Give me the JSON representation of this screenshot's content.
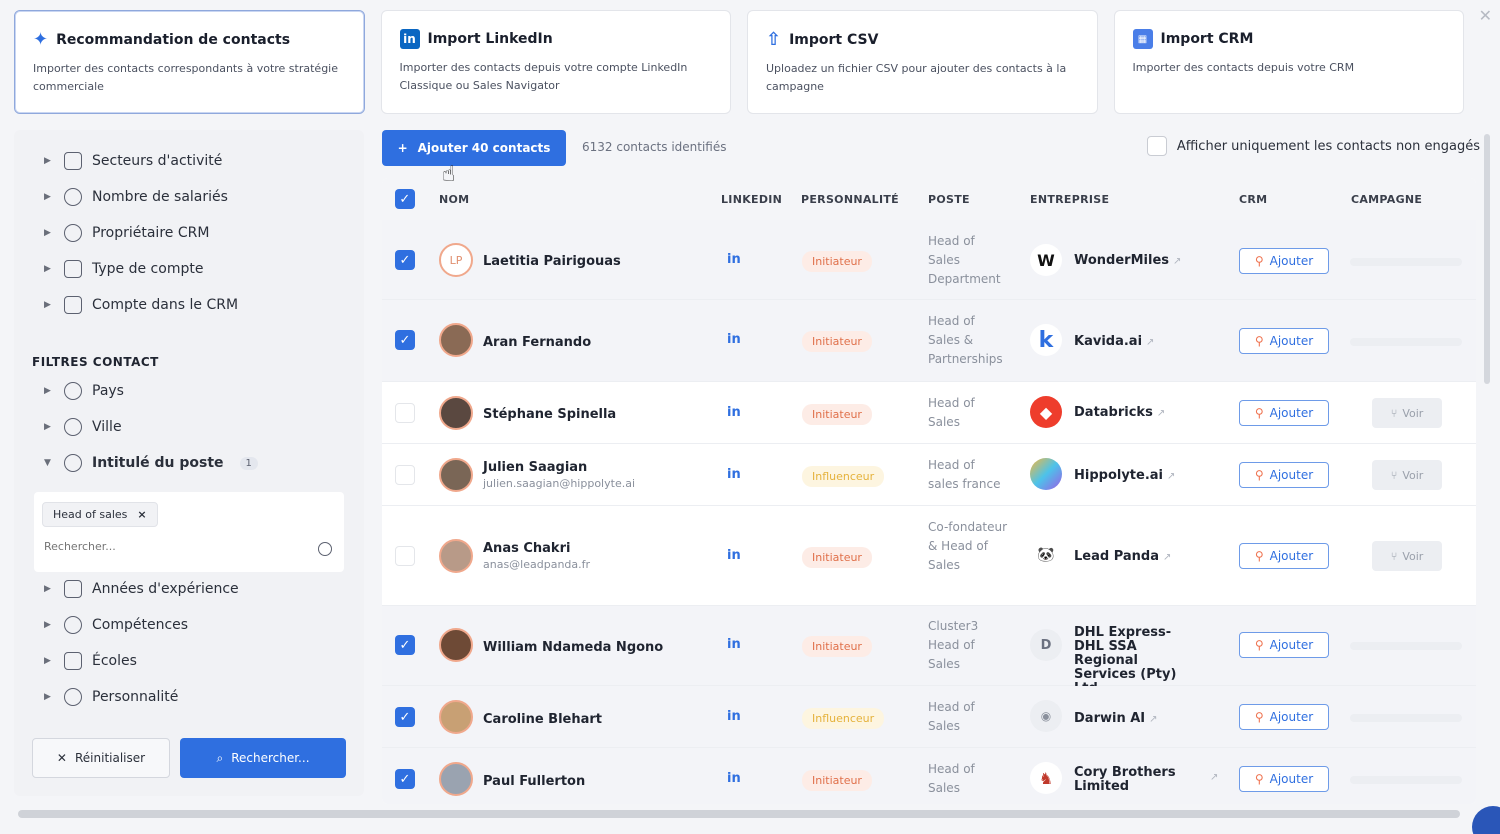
{
  "import_cards": [
    {
      "title": "Recommandation de contacts",
      "desc": "Importer des contacts correspondants à votre stratégie commerciale",
      "icon": "sparkles-icon"
    },
    {
      "title": "Import LinkedIn",
      "desc": "Importer des contacts depuis votre compte LinkedIn Classique ou Sales Navigator",
      "icon": "linkedin-icon"
    },
    {
      "title": "Import CSV",
      "desc": "Uploadez un fichier CSV pour ajouter des contacts à la campagne",
      "icon": "upload-icon"
    },
    {
      "title": "Import CRM",
      "desc": "Importer des contacts depuis votre CRM",
      "icon": "crm-icon"
    }
  ],
  "sidebar": {
    "company_filters": [
      {
        "label": "Secteurs d'activité",
        "icon": "truck-icon"
      },
      {
        "label": "Nombre de salariés",
        "icon": "users-icon"
      },
      {
        "label": "Propriétaire CRM",
        "icon": "user-icon"
      },
      {
        "label": "Type de compte",
        "icon": "handshake-icon"
      },
      {
        "label": "Compte dans le CRM",
        "icon": "building-icon"
      }
    ],
    "section_title": "FILTRES CONTACT",
    "contact_filters_top": [
      {
        "label": "Pays",
        "icon": "pin-icon"
      },
      {
        "label": "Ville",
        "icon": "pin-icon"
      }
    ],
    "job_filter": {
      "label": "Intitulé du poste",
      "count": "1",
      "chip": "Head of sales",
      "chip_remove": "×",
      "search_placeholder": "Rechercher..."
    },
    "contact_filters_bottom": [
      {
        "label": "Années d'expérience",
        "icon": "calendar-icon"
      },
      {
        "label": "Compétences",
        "icon": "bulb-icon"
      },
      {
        "label": "Écoles",
        "icon": "graduation-icon"
      },
      {
        "label": "Personnalité",
        "icon": "target-icon"
      }
    ],
    "reset_label": "Réinitialiser",
    "search_label": "Rechercher..."
  },
  "toolbar": {
    "add_label": "Ajouter 40 contacts",
    "count_text": "6132 contacts identifiés",
    "only_label": "Afficher uniquement les contacts non engagés"
  },
  "table": {
    "headers": {
      "nom": "NOM",
      "linkedin": "LINKEDIN",
      "perso": "PERSONNALITÉ",
      "poste": "POSTE",
      "entreprise": "ENTREPRISE",
      "crm": "CRM",
      "campagne": "CAMPAGNE"
    },
    "crm_label": "Ajouter",
    "voir_label": "Voir",
    "li_label": "in",
    "rows": [
      {
        "name": "Laetitia Pairigouas",
        "email": "",
        "initials": "LP",
        "perso": "Initiateur",
        "poste": "Head of Sales Department",
        "company": "WonderMiles",
        "logo": "W",
        "checked": true
      },
      {
        "name": "Aran Fernando",
        "email": "",
        "initials": "",
        "perso": "Initiateur",
        "poste": "Head of Sales & Partnerships",
        "company": "Kavida.ai",
        "logo": "k",
        "checked": true
      },
      {
        "name": "Stéphane Spinella",
        "email": "",
        "initials": "",
        "perso": "Initiateur",
        "poste": "Head of Sales",
        "company": "Databricks",
        "logo": "",
        "checked": false
      },
      {
        "name": "Julien Saagian",
        "email": "julien.saagian@hippolyte.ai",
        "initials": "",
        "perso": "Influenceur",
        "poste": "Head of sales france",
        "company": "Hippolyte.ai",
        "logo": "",
        "checked": false
      },
      {
        "name": "Anas Chakri",
        "email": "anas@leadpanda.fr",
        "initials": "",
        "perso": "Initiateur",
        "poste": "Co-fondateur & Head of Sales",
        "company": "Lead Panda",
        "logo": "",
        "checked": false
      },
      {
        "name": "William Ndameda Ngono",
        "email": "",
        "initials": "",
        "perso": "Initiateur",
        "poste": "Cluster3 Head of Sales",
        "company": "DHL Express- DHL SSA Regional Services (Pty) Ltd",
        "logo": "D",
        "checked": true
      },
      {
        "name": "Caroline Blehart",
        "email": "",
        "initials": "",
        "perso": "Influenceur",
        "poste": "Head of Sales",
        "company": "Darwin AI",
        "logo": "",
        "checked": true
      },
      {
        "name": "Paul Fullerton",
        "email": "",
        "initials": "",
        "perso": "Initiateur",
        "poste": "Head of Sales",
        "company": "Cory Brothers Limited",
        "logo": "",
        "checked": true
      }
    ]
  },
  "colors": {
    "accent": "#2f6fe0",
    "initiateur": "#e0704a",
    "influenceur": "#e5b23c",
    "hubspot": "#ef7350"
  }
}
